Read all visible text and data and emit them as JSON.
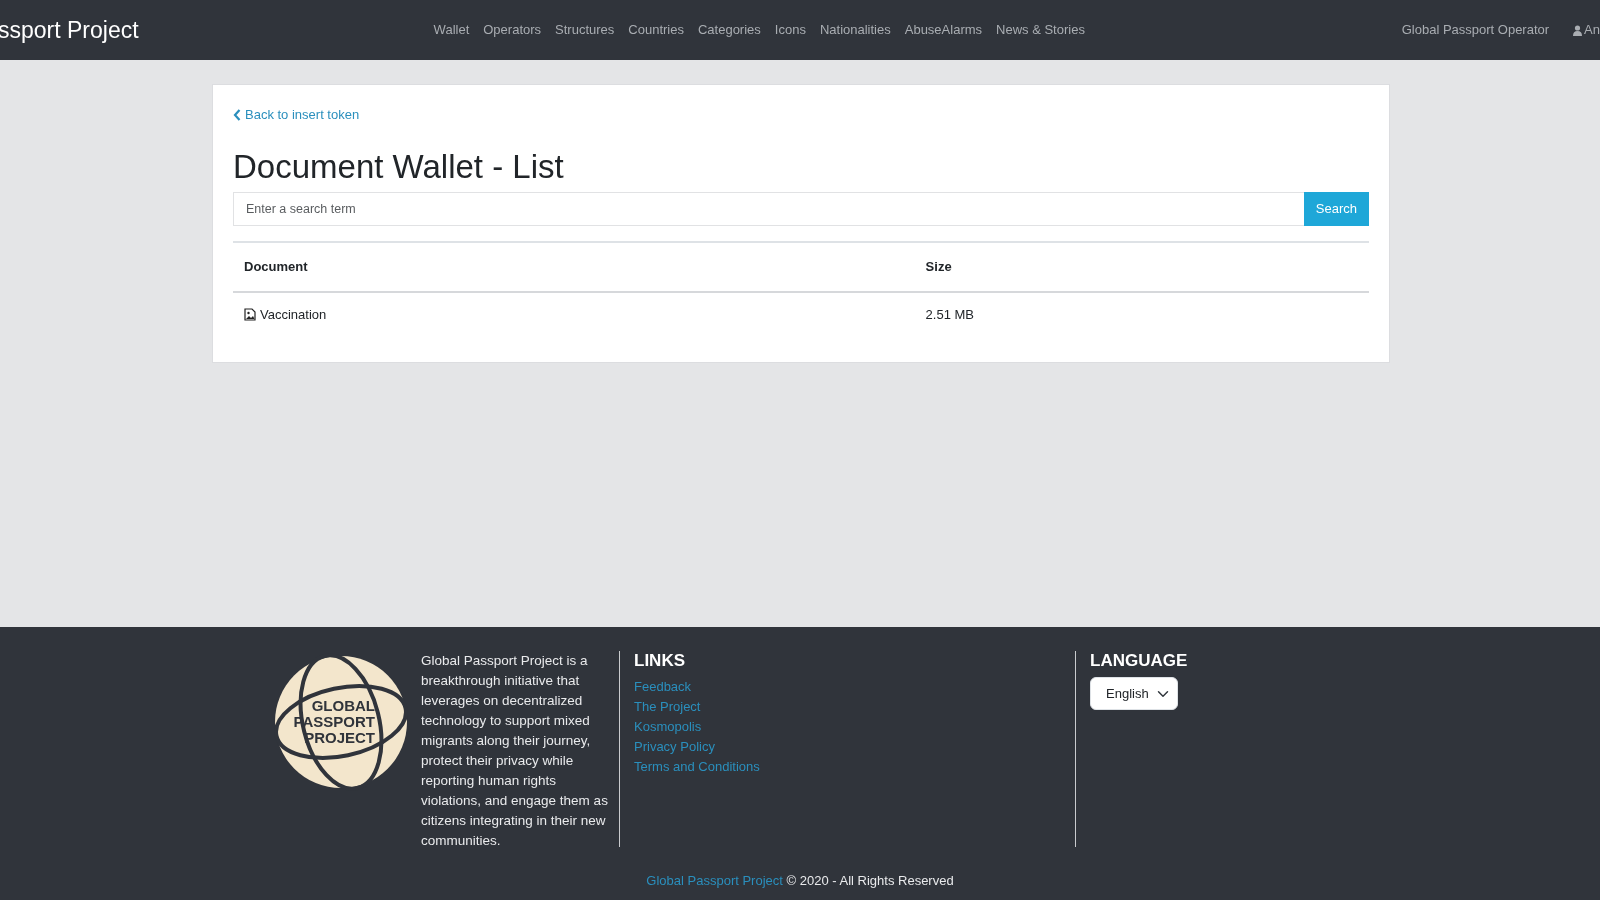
{
  "navbar": {
    "brand": "ssport Project",
    "links": [
      {
        "label": "Wallet"
      },
      {
        "label": "Operators"
      },
      {
        "label": "Structures"
      },
      {
        "label": "Countries"
      },
      {
        "label": "Categories"
      },
      {
        "label": "Icons"
      },
      {
        "label": "Nationalities"
      },
      {
        "label": "AbuseAlarms"
      },
      {
        "label": "News & Stories"
      }
    ],
    "right_link": "Global Passport Operator",
    "user": "An"
  },
  "back_link": "Back to insert token",
  "title": "Document Wallet - List",
  "search": {
    "placeholder": "Enter a search term",
    "button": "Search"
  },
  "table": {
    "columns": [
      "Document",
      "Size"
    ],
    "rows": [
      {
        "document": "Vaccination",
        "size": "2.51 MB"
      }
    ]
  },
  "footer": {
    "logo_lines": [
      "GLOBAL",
      "PASSPORT",
      "PROJECT"
    ],
    "about": "Global Passport Project is a breakthrough initiative that leverages on decentralized technology to support mixed migrants along their journey, protect their privacy while reporting human rights violations, and engage them as citizens integrating in their new communities.",
    "links_title": "LINKS",
    "links": [
      "Feedback",
      "The Project",
      "Kosmopolis",
      "Privacy Policy",
      "Terms and Conditions"
    ],
    "language_title": "LANGUAGE",
    "language": "English",
    "copyright_link": "Global Passport Project",
    "copyright": "© 2020 - All Rights Reserved"
  }
}
